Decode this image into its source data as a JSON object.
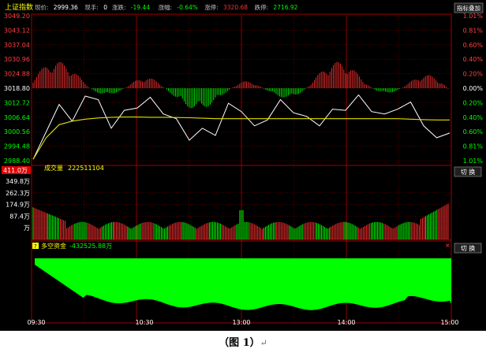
{
  "header": {
    "index_name": "上证指数",
    "fields": [
      {
        "label": "现价:",
        "value": "2999.36",
        "color": "#ffffff"
      },
      {
        "label": "现手:",
        "value": "0",
        "color": "#ffffff"
      },
      {
        "label": "涨跌:",
        "value": "-19.44",
        "color": "#00ff00"
      },
      {
        "label": "涨幅:",
        "value": "-0.64%",
        "color": "#00ff00"
      },
      {
        "label": "涨停:",
        "value": "3320.68",
        "color": "#ff3030"
      },
      {
        "label": "跌停:",
        "value": "2716.92",
        "color": "#00ff00"
      }
    ],
    "right_button": "指标叠加"
  },
  "price_axis": {
    "left": [
      "3049.20",
      "3043.12",
      "3037.04",
      "3030.96",
      "3024.88",
      "3018.80",
      "3012.72",
      "3006.64",
      "3000.56",
      "2994.48",
      "2988.40"
    ],
    "right": [
      "1.01%",
      "0.81%",
      "0.60%",
      "0.40%",
      "0.20%",
      "0.00%",
      "0.20%",
      "0.40%",
      "0.60%",
      "0.81%",
      "1.01%"
    ]
  },
  "volume_panel": {
    "label": "成交量",
    "value": "222511104",
    "max_label": "411.0万",
    "ticks": [
      "349.8万",
      "262.3万",
      "174.9万",
      "87.4万",
      "万"
    ],
    "button": "切 换"
  },
  "fund_panel": {
    "label": "多空资金",
    "value": "-432525.88万",
    "button": "切 换",
    "close": "×"
  },
  "top_button": "切 换",
  "time_axis": [
    "09:30",
    "10:30",
    "13:00",
    "14:00",
    "15:00"
  ],
  "caption": {
    "text": "（图 1）",
    "mark": "↵"
  },
  "colors": {
    "up": "#ff3030",
    "down": "#00ff00",
    "price_line": "#ffffff",
    "avg_line": "#e0e000",
    "grid": "#800000",
    "fund_area": "#00ff00",
    "axis_text": "#ff4040"
  },
  "chart_data": {
    "type": "line",
    "x": [
      "09:30",
      "10:30",
      "13:00",
      "14:00",
      "15:00"
    ],
    "ylim": [
      2988.4,
      3049.2
    ],
    "series": [
      {
        "values": [
          2989.0,
          3000.5,
          3012.0,
          3005.0,
          3015.5,
          3014.0,
          3002.0,
          3009.5,
          3010.5,
          3015.0,
          3008.0,
          3006.0,
          2997.0,
          3002.0,
          2999.0,
          3012.5,
          3009.0,
          3003.0,
          3005.5,
          3014.0,
          3008.5,
          3007.0,
          3003.0,
          3010.0,
          3009.5,
          3016.0,
          3009.0,
          3008.0,
          3010.0,
          3013.0,
          3003.0,
          2998.0,
          3000.0
        ]
      },
      {
        "values": [
          2989.0,
          2998.0,
          3003.5,
          3005.0,
          3005.8,
          3006.3,
          3006.6,
          3006.7,
          3006.7,
          3006.6,
          3006.6,
          3006.5,
          3006.4,
          3006.2,
          3006.0,
          3006.0,
          3006.0,
          3006.0,
          3006.0,
          3006.0,
          3006.0,
          3006.0,
          3006.0,
          3006.0,
          3006.0,
          3006.0,
          3006.0,
          3006.0,
          3006.0,
          3005.8,
          3005.6,
          3005.5,
          3005.5
        ]
      }
    ]
  }
}
